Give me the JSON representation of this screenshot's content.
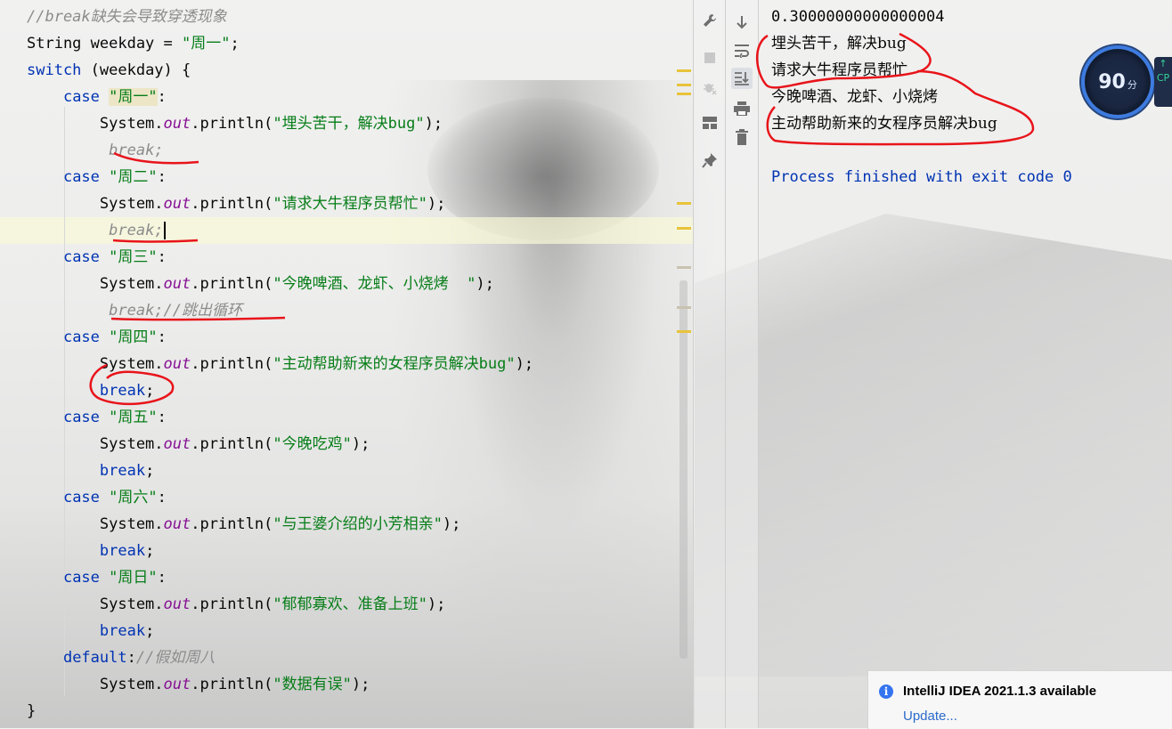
{
  "editor": {
    "lines": [
      {
        "parts": [
          {
            "t": "//break缺失会导致穿透现象",
            "c": "cmt"
          }
        ]
      },
      {
        "parts": [
          {
            "t": "String weekday = ",
            "c": "plain"
          },
          {
            "t": "\"周一\"",
            "c": "str"
          },
          {
            "t": ";",
            "c": "plain"
          }
        ]
      },
      {
        "parts": [
          {
            "t": "switch",
            "c": "kw"
          },
          {
            "t": " (weekday) {",
            "c": "plain"
          }
        ]
      },
      {
        "parts": [
          {
            "t": "    ",
            "c": "plain"
          },
          {
            "t": "case",
            "c": "kw"
          },
          {
            "t": " ",
            "c": "plain"
          },
          {
            "t": "\"周一\"",
            "c": "str-hl"
          },
          {
            "t": ":",
            "c": "plain"
          }
        ]
      },
      {
        "parts": [
          {
            "t": "        System.",
            "c": "plain"
          },
          {
            "t": "out",
            "c": "ital"
          },
          {
            "t": ".println(",
            "c": "plain"
          },
          {
            "t": "\"埋头苦干，解决bug\"",
            "c": "str"
          },
          {
            "t": ");",
            "c": "plain"
          }
        ]
      },
      {
        "parts": [
          {
            "t": "         ",
            "c": "plain"
          },
          {
            "t": "break;",
            "c": "brk-gray"
          }
        ]
      },
      {
        "parts": [
          {
            "t": "    ",
            "c": "plain"
          },
          {
            "t": "case",
            "c": "kw"
          },
          {
            "t": " ",
            "c": "plain"
          },
          {
            "t": "\"周二\"",
            "c": "str"
          },
          {
            "t": ":",
            "c": "plain"
          }
        ]
      },
      {
        "parts": [
          {
            "t": "        System.",
            "c": "plain"
          },
          {
            "t": "out",
            "c": "ital"
          },
          {
            "t": ".println(",
            "c": "plain"
          },
          {
            "t": "\"请求大牛程序员帮忙\"",
            "c": "str"
          },
          {
            "t": ");",
            "c": "plain"
          }
        ]
      },
      {
        "parts": [
          {
            "t": "         ",
            "c": "plain"
          },
          {
            "t": "break;",
            "c": "brk-gray"
          }
        ],
        "cursor": true
      },
      {
        "parts": [
          {
            "t": "    ",
            "c": "plain"
          },
          {
            "t": "case",
            "c": "kw"
          },
          {
            "t": " ",
            "c": "plain"
          },
          {
            "t": "\"周三\"",
            "c": "str"
          },
          {
            "t": ":",
            "c": "plain"
          }
        ]
      },
      {
        "parts": [
          {
            "t": "        System.",
            "c": "plain"
          },
          {
            "t": "out",
            "c": "ital"
          },
          {
            "t": ".println(",
            "c": "plain"
          },
          {
            "t": "\"今晚啤酒、龙虾、小烧烤  \"",
            "c": "str"
          },
          {
            "t": ");",
            "c": "plain"
          }
        ]
      },
      {
        "parts": [
          {
            "t": "         ",
            "c": "plain"
          },
          {
            "t": "break;//跳出循环",
            "c": "brk-gray"
          }
        ]
      },
      {
        "parts": [
          {
            "t": "    ",
            "c": "plain"
          },
          {
            "t": "case",
            "c": "kw"
          },
          {
            "t": " ",
            "c": "plain"
          },
          {
            "t": "\"周四\"",
            "c": "str"
          },
          {
            "t": ":",
            "c": "plain"
          }
        ]
      },
      {
        "parts": [
          {
            "t": "        System.",
            "c": "plain"
          },
          {
            "t": "out",
            "c": "ital"
          },
          {
            "t": ".println(",
            "c": "plain"
          },
          {
            "t": "\"主动帮助新来的女程序员解决bug\"",
            "c": "str"
          },
          {
            "t": ");",
            "c": "plain"
          }
        ]
      },
      {
        "parts": [
          {
            "t": "        ",
            "c": "plain"
          },
          {
            "t": "break",
            "c": "kw"
          },
          {
            "t": ";",
            "c": "plain"
          }
        ]
      },
      {
        "parts": [
          {
            "t": "    ",
            "c": "plain"
          },
          {
            "t": "case",
            "c": "kw"
          },
          {
            "t": " ",
            "c": "plain"
          },
          {
            "t": "\"周五\"",
            "c": "str"
          },
          {
            "t": ":",
            "c": "plain"
          }
        ]
      },
      {
        "parts": [
          {
            "t": "        System.",
            "c": "plain"
          },
          {
            "t": "out",
            "c": "ital"
          },
          {
            "t": ".println(",
            "c": "plain"
          },
          {
            "t": "\"今晚吃鸡\"",
            "c": "str"
          },
          {
            "t": ");",
            "c": "plain"
          }
        ]
      },
      {
        "parts": [
          {
            "t": "        ",
            "c": "plain"
          },
          {
            "t": "break",
            "c": "kw"
          },
          {
            "t": ";",
            "c": "plain"
          }
        ]
      },
      {
        "parts": [
          {
            "t": "    ",
            "c": "plain"
          },
          {
            "t": "case",
            "c": "kw"
          },
          {
            "t": " ",
            "c": "plain"
          },
          {
            "t": "\"周六\"",
            "c": "str"
          },
          {
            "t": ":",
            "c": "plain"
          }
        ]
      },
      {
        "parts": [
          {
            "t": "        System.",
            "c": "plain"
          },
          {
            "t": "out",
            "c": "ital"
          },
          {
            "t": ".println(",
            "c": "plain"
          },
          {
            "t": "\"与王婆介绍的小芳相亲\"",
            "c": "str"
          },
          {
            "t": ");",
            "c": "plain"
          }
        ]
      },
      {
        "parts": [
          {
            "t": "        ",
            "c": "plain"
          },
          {
            "t": "break",
            "c": "kw"
          },
          {
            "t": ";",
            "c": "plain"
          }
        ]
      },
      {
        "parts": [
          {
            "t": "    ",
            "c": "plain"
          },
          {
            "t": "case",
            "c": "kw"
          },
          {
            "t": " ",
            "c": "plain"
          },
          {
            "t": "\"周日\"",
            "c": "str"
          },
          {
            "t": ":",
            "c": "plain"
          }
        ]
      },
      {
        "parts": [
          {
            "t": "        System.",
            "c": "plain"
          },
          {
            "t": "out",
            "c": "ital"
          },
          {
            "t": ".println(",
            "c": "plain"
          },
          {
            "t": "\"郁郁寡欢、准备上班\"",
            "c": "str"
          },
          {
            "t": ");",
            "c": "plain"
          }
        ]
      },
      {
        "parts": [
          {
            "t": "        ",
            "c": "plain"
          },
          {
            "t": "break",
            "c": "kw"
          },
          {
            "t": ";",
            "c": "plain"
          }
        ]
      },
      {
        "parts": [
          {
            "t": "    ",
            "c": "plain"
          },
          {
            "t": "default",
            "c": "kw"
          },
          {
            "t": ":",
            "c": "plain"
          },
          {
            "t": "//假如周八",
            "c": "cmt"
          }
        ]
      },
      {
        "parts": [
          {
            "t": "        System.",
            "c": "plain"
          },
          {
            "t": "out",
            "c": "ital"
          },
          {
            "t": ".println(",
            "c": "plain"
          },
          {
            "t": "\"数据有误\"",
            "c": "str"
          },
          {
            "t": ");",
            "c": "plain"
          }
        ]
      },
      {
        "parts": [
          {
            "t": "}",
            "c": "plain"
          }
        ]
      }
    ]
  },
  "toolbar": {
    "left_icons": [
      "wrench-icon",
      "stop-icon",
      "debug-icon",
      "layout-icon",
      "pin-icon"
    ],
    "right_icons": [
      "scroll-down-icon",
      "soft-wrap-icon",
      "scroll-to-end-icon",
      "print-icon",
      "trash-icon"
    ]
  },
  "console": {
    "first": "0.30000000000000004",
    "outputs": [
      "埋头苦干，解决bug",
      "请求大牛程序员帮忙",
      "今晚啤酒、龙虾、小烧烤",
      "主动帮助新来的女程序员解决bug"
    ],
    "finished": "Process finished with exit code 0"
  },
  "widget": {
    "value": "90",
    "unit": "分",
    "side_top": "↑",
    "side_bottom": "CP"
  },
  "notification": {
    "title": "IntelliJ IDEA 2021.1.3 available",
    "link": "Update..."
  },
  "colors": {
    "keyword": "#0033b3",
    "string": "#067d17",
    "field": "#871094",
    "comment": "#8c8c8c",
    "annotation": "#e8141a",
    "link": "#2a6acb"
  }
}
